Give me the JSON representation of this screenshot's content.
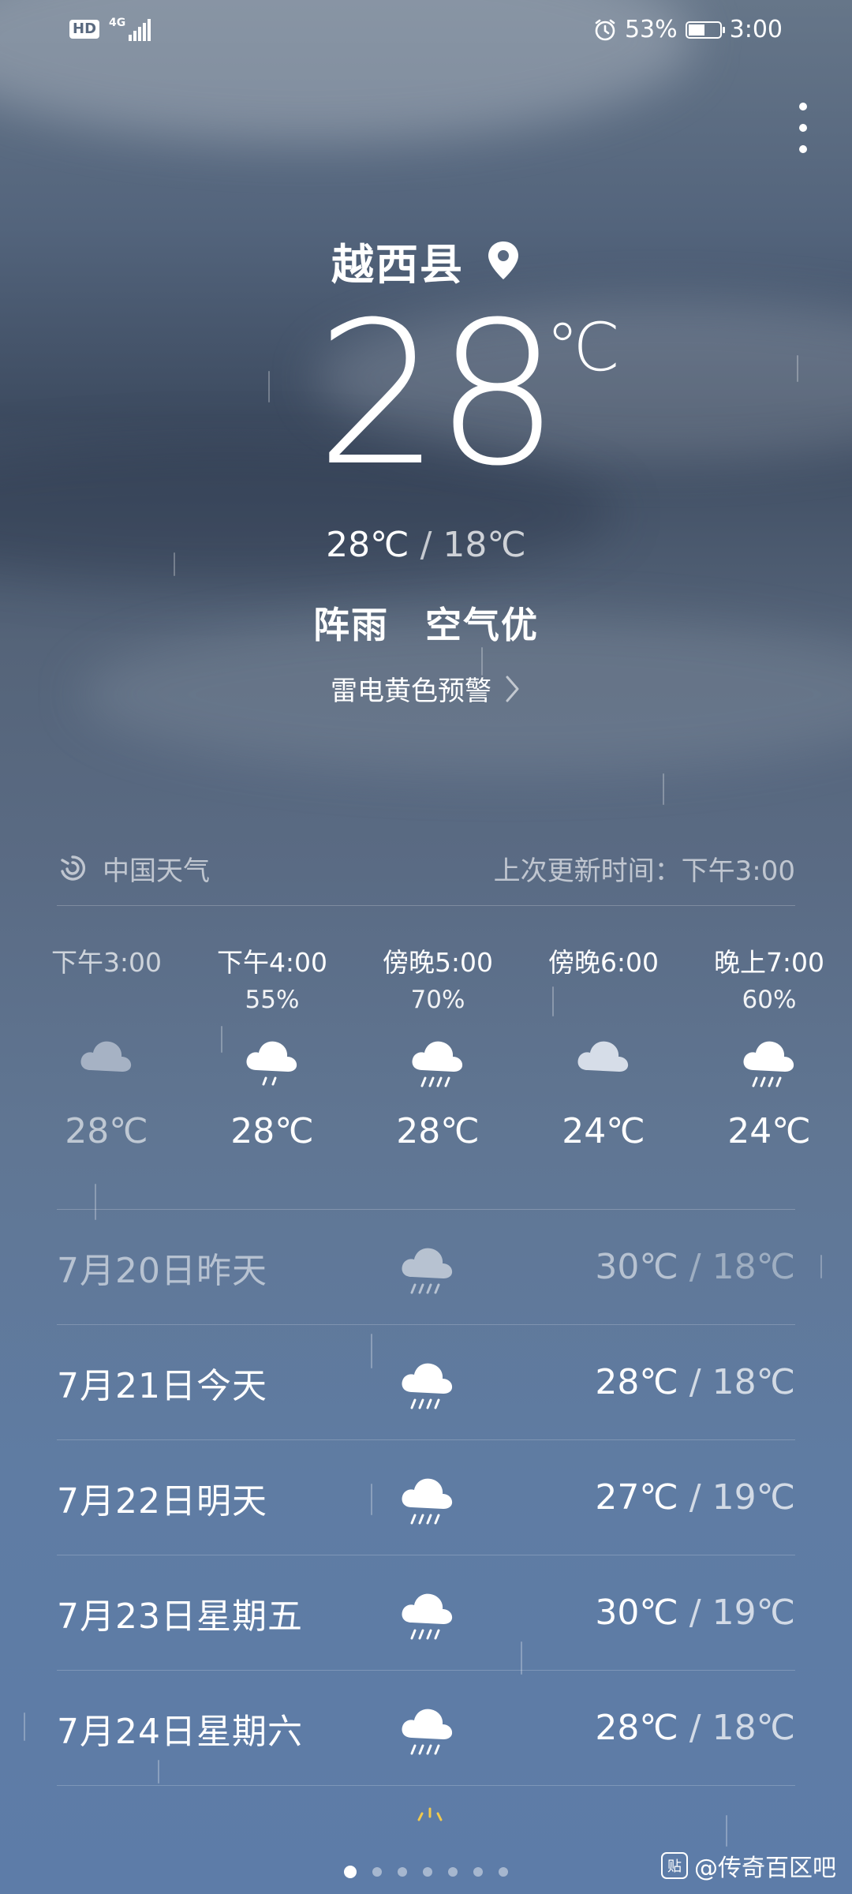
{
  "status_bar": {
    "hd": "HD",
    "network": "4G",
    "battery_percent": "53%",
    "battery_level": 0.53,
    "time": "3:00"
  },
  "location": {
    "city": "越西县"
  },
  "current": {
    "temp": "28",
    "unit": "℃",
    "high": "28℃",
    "range_sep": "/",
    "low": "18℃",
    "condition": "阵雨",
    "air_quality": "空气优",
    "alert": "雷电黄色预警"
  },
  "source": {
    "name": "中国天气",
    "updated": "上次更新时间：下午3:00"
  },
  "hourly": [
    {
      "time": "下午3:00",
      "pop": "",
      "icon": "cloudy-icon",
      "temp": "28℃",
      "dim": true
    },
    {
      "time": "下午4:00",
      "pop": "55%",
      "icon": "light-rain-icon",
      "temp": "28℃",
      "dim": false
    },
    {
      "time": "傍晚5:00",
      "pop": "70%",
      "icon": "shower-rain-icon",
      "temp": "28℃",
      "dim": false
    },
    {
      "time": "傍晚6:00",
      "pop": "",
      "icon": "cloudy-icon",
      "temp": "24℃",
      "dim": false
    },
    {
      "time": "晚上7:00",
      "pop": "60%",
      "icon": "shower-rain-icon",
      "temp": "24℃",
      "dim": false
    }
  ],
  "daily": [
    {
      "label": "7月20日昨天",
      "icon": "shower-rain-icon",
      "high": "30℃",
      "sep": "/",
      "low": "18℃",
      "dim": true
    },
    {
      "label": "7月21日今天",
      "icon": "shower-rain-icon",
      "high": "28℃",
      "sep": "/",
      "low": "18℃",
      "dim": false
    },
    {
      "label": "7月22日明天",
      "icon": "shower-rain-icon",
      "high": "27℃",
      "sep": "/",
      "low": "19℃",
      "dim": false
    },
    {
      "label": "7月23日星期五",
      "icon": "shower-rain-icon",
      "high": "30℃",
      "sep": "/",
      "low": "19℃",
      "dim": false
    },
    {
      "label": "7月24日星期六",
      "icon": "shower-rain-icon",
      "high": "28℃",
      "sep": "/",
      "low": "18℃",
      "dim": false
    }
  ],
  "pager": {
    "count": 7,
    "active": 0
  },
  "watermark": {
    "badge": "贴",
    "text": "@传奇百区吧"
  }
}
